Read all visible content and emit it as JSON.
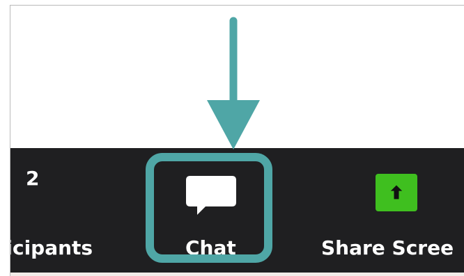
{
  "toolbar": {
    "participants": {
      "count": "2",
      "label": "ticipants"
    },
    "chat": {
      "label": "Chat",
      "icon": "chat-bubble-icon"
    },
    "share_screen": {
      "label": "Share Scree",
      "icon": "share-screen-up-arrow-icon"
    }
  },
  "colors": {
    "toolbar_background": "#1f1f21",
    "highlight": "#4fa6a6",
    "share_button": "#3fbf1f",
    "text": "#ffffff"
  }
}
